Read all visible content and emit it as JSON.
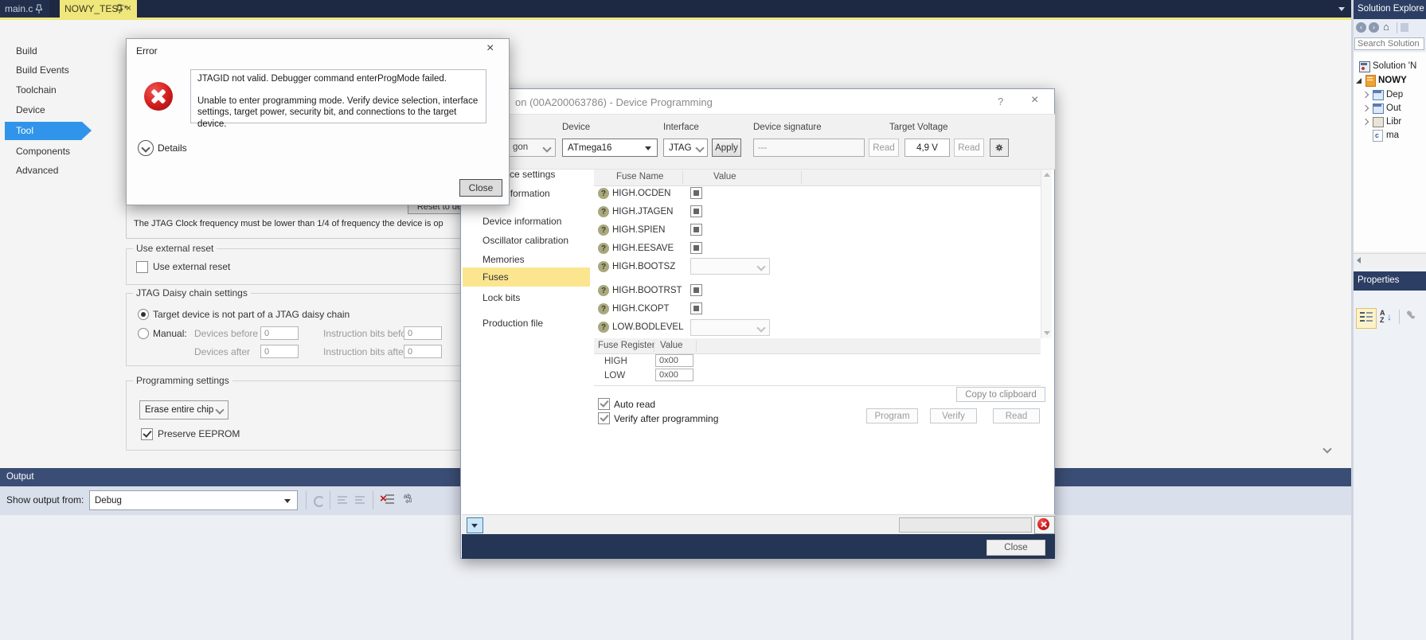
{
  "tabs": {
    "tab1": "main.c",
    "tab2": "NOWY_TEST*"
  },
  "sidebar": {
    "items": [
      "Build",
      "Build Events",
      "Toolchain",
      "Device",
      "Tool",
      "Components",
      "Advanced"
    ]
  },
  "tool_page": {
    "reset_button": "Reset to de",
    "jtag_note": "The JTAG Clock frequency must be lower than 1/4 of frequency the device is op",
    "ext_reset_group": "Use external reset",
    "ext_reset_checkbox": "Use external reset",
    "daisy_group": "JTAG Daisy chain settings",
    "radio_target": "Target device is not part of a JTAG daisy chain",
    "radio_manual": "Manual:",
    "devices_before_label": "Devices before",
    "devices_before_value": "0",
    "instr_before_label": "Instruction bits before",
    "instr_before_value": "0",
    "devices_after_label": "Devices after",
    "devices_after_value": "0",
    "instr_after_label": "Instruction bits after",
    "instr_after_value": "0",
    "prog_group": "Programming settings",
    "erase_dropdown": "Erase entire chip",
    "preserve_checkbox": "Preserve EEPROM"
  },
  "error_dialog": {
    "title": "Error",
    "close_x": "×",
    "message_line1": "JTAGID not valid. Debugger command enterProgMode failed.",
    "message_line2": "Unable to enter programming mode. Verify device selection, interface settings, target power, security bit, and connections to the target device.",
    "details_label": "Details",
    "close_button": "Close"
  },
  "prog_dialog": {
    "title": "on (00A200063786) - Device Programming",
    "help": "?",
    "close_x": "×",
    "tool_value": "gon",
    "device_label": "Device",
    "device_value": "ATmega16",
    "interface_label": "Interface",
    "interface_value": "JTAG",
    "apply_button": "Apply",
    "signature_label": "Device signature",
    "signature_value": "---",
    "signature_read": "Read",
    "voltage_label": "Target Voltage",
    "voltage_value": "4,9 V",
    "voltage_read": "Read",
    "nav": [
      "Interface settings",
      "Tool information",
      "Device information",
      "Oscillator calibration",
      "Memories",
      "Fuses",
      "Lock bits",
      "Production file"
    ],
    "fuse_header_name": "Fuse Name",
    "fuse_header_value": "Value",
    "fuses": [
      {
        "name": "HIGH.OCDEN",
        "control": "checkbox"
      },
      {
        "name": "HIGH.JTAGEN",
        "control": "checkbox"
      },
      {
        "name": "HIGH.SPIEN",
        "control": "checkbox"
      },
      {
        "name": "HIGH.EESAVE",
        "control": "checkbox"
      },
      {
        "name": "HIGH.BOOTSZ",
        "control": "dropdown"
      },
      {
        "name": "HIGH.BOOTRST",
        "control": "checkbox"
      },
      {
        "name": "HIGH.CKOPT",
        "control": "checkbox"
      },
      {
        "name": "LOW.BODLEVEL",
        "control": "dropdown"
      }
    ],
    "register_header": "Fuse Register",
    "register_value_header": "Value",
    "registers": [
      {
        "name": "HIGH",
        "value": "0x00"
      },
      {
        "name": "LOW",
        "value": "0x00"
      }
    ],
    "copy_button": "Copy to clipboard",
    "auto_read_label": "Auto read",
    "verify_after_label": "Verify after programming",
    "program_button": "Program",
    "verify_button": "Verify",
    "read_button": "Read",
    "close_button": "Close"
  },
  "output_panel": {
    "title": "Output",
    "show_label": "Show output from:",
    "combo_value": "Debug"
  },
  "solution_explorer": {
    "title": "Solution Explore",
    "search_placeholder": "Search Solution",
    "tree": [
      "Solution 'N",
      "NOWY",
      "Dep",
      "Out",
      "Libr",
      "ma"
    ]
  },
  "properties_panel": {
    "title": "Properties"
  },
  "colors": {
    "accent_blue": "#3095ea",
    "selection_yellow": "#fbe58f",
    "tab_yellow": "#efe67c",
    "titlebar_navy": "#2c3e63",
    "error_red": "#c0150f"
  }
}
